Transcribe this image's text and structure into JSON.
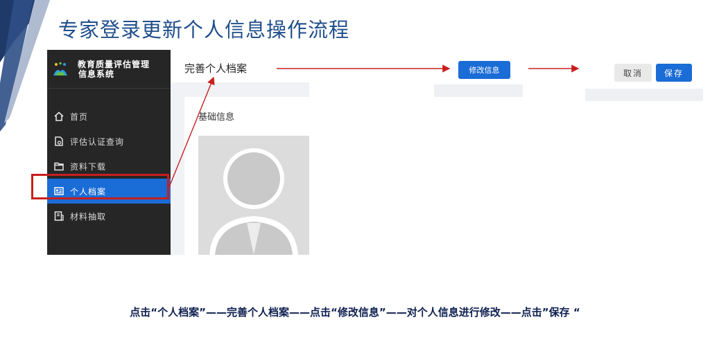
{
  "slide": {
    "title": "专家登录更新个人信息操作流程",
    "caption": "点击“个人档案”——完善个人档案——点击“修改信息”——对个人信息进行修改——点击”保存 “"
  },
  "sidebar": {
    "app_name_line1": "教育质量评估管理",
    "app_name_line2": "信息系统",
    "items": [
      {
        "label": "首页",
        "icon": "home-icon"
      },
      {
        "label": "评估认证查询",
        "icon": "document-search-icon"
      },
      {
        "label": "资料下载",
        "icon": "folder-icon"
      },
      {
        "label": "个人档案",
        "icon": "profile-card-icon",
        "active": true
      },
      {
        "label": "材料抽取",
        "icon": "extract-document-icon"
      }
    ]
  },
  "main": {
    "title": "完善个人档案",
    "section_title": "基础信息"
  },
  "buttons": {
    "modify": "修改信息",
    "cancel": "取消",
    "save": "保存"
  },
  "colors": {
    "title": "#1f4e8c",
    "sidebar_bg": "#262626",
    "accent": "#1a6cd6",
    "highlight": "#c81e1e",
    "caption": "#0d1f4f"
  }
}
